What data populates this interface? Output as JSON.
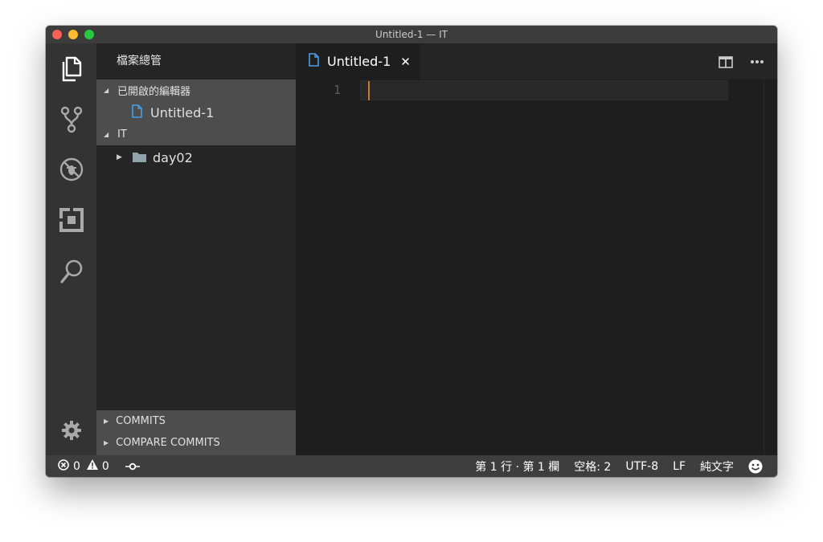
{
  "window": {
    "title": "Untitled-1 — IT"
  },
  "activity_bar": {
    "items": [
      "explorer-icon",
      "source-control-icon",
      "debug-icon",
      "extensions-icon",
      "search-icon"
    ],
    "settings_icon": "gear-icon"
  },
  "sidebar": {
    "title": "檔案總管",
    "open_editors": {
      "header": "已開啟的編輯器",
      "files": [
        {
          "name": "Untitled-1",
          "icon": "file-icon"
        }
      ]
    },
    "workspace": {
      "header": "IT",
      "items": [
        {
          "name": "day02",
          "icon": "folder-icon"
        }
      ]
    },
    "bottom_sections": [
      "COMMITS",
      "COMPARE COMMITS"
    ]
  },
  "tabs": [
    {
      "label": "Untitled-1",
      "active": true
    }
  ],
  "editor": {
    "line_numbers": [
      "1"
    ],
    "accent_cursor": "#c8792c"
  },
  "status_bar": {
    "errors": "0",
    "warnings": "0",
    "position": "第 1 行 · 第 1 欄",
    "indent": "空格: 2",
    "encoding": "UTF-8",
    "eol": "LF",
    "language": "純文字",
    "feedback_icon": "smiley-icon"
  },
  "colors": {
    "activity_bg": "#333333",
    "sidebar_bg": "#252526",
    "editor_bg": "#1e1e1e",
    "status_bg": "#3e3e3e",
    "file_icon_blue": "#4a9ee8"
  }
}
